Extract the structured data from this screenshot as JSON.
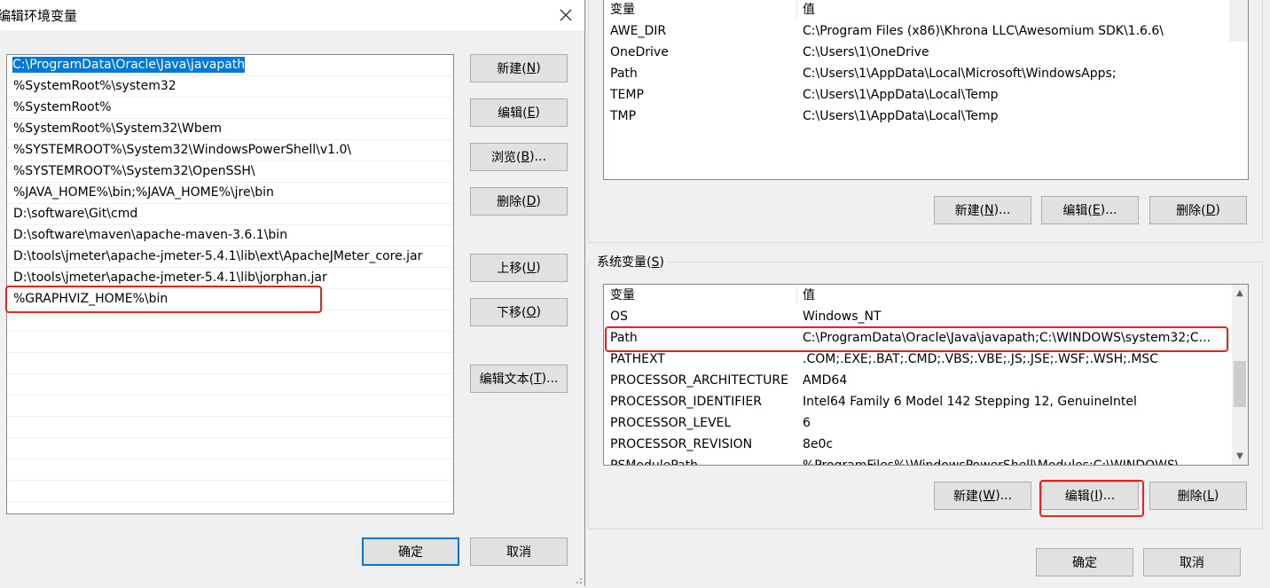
{
  "edit_dialog": {
    "title": "编辑环境变量",
    "entries": [
      "C:\\ProgramData\\Oracle\\Java\\javapath",
      "%SystemRoot%\\system32",
      "%SystemRoot%",
      "%SystemRoot%\\System32\\Wbem",
      "%SYSTEMROOT%\\System32\\WindowsPowerShell\\v1.0\\",
      "%SYSTEMROOT%\\System32\\OpenSSH\\",
      "%JAVA_HOME%\\bin;%JAVA_HOME%\\jre\\bin",
      "D:\\software\\Git\\cmd",
      "D:\\software\\maven\\apache-maven-3.6.1\\bin",
      "D:\\tools\\jmeter\\apache-jmeter-5.4.1\\lib\\ext\\ApacheJMeter_core.jar",
      "D:\\tools\\jmeter\\apache-jmeter-5.4.1\\lib\\jorphan.jar",
      "%GRAPHVIZ_HOME%\\bin"
    ],
    "selected_entry": "C:\\ProgramData\\Oracle\\Java\\javapath",
    "buttons": {
      "new": {
        "label": "新建(",
        "key": "N",
        "end": ")"
      },
      "edit": {
        "label": "编辑(",
        "key": "E",
        "end": ")"
      },
      "browse": {
        "label": "浏览(",
        "key": "B",
        "end": ")..."
      },
      "delete": {
        "label": "删除(",
        "key": "D",
        "end": ")"
      },
      "move_up": {
        "label": "上移(",
        "key": "U",
        "end": ")"
      },
      "move_down": {
        "label": "下移(",
        "key": "O",
        "end": ")"
      },
      "edit_text": {
        "label": "编辑文本(",
        "key": "T",
        "end": ")..."
      },
      "ok": "确定",
      "cancel": "取消"
    }
  },
  "env_dialog": {
    "user_vars": {
      "col_variable": "变量",
      "col_value": "值",
      "rows": [
        {
          "name": "AWE_DIR",
          "value": "C:\\Program Files (x86)\\Khrona LLC\\Awesomium SDK\\1.6.6\\"
        },
        {
          "name": "OneDrive",
          "value": "C:\\Users\\1\\OneDrive"
        },
        {
          "name": "Path",
          "value": "C:\\Users\\1\\AppData\\Local\\Microsoft\\WindowsApps;"
        },
        {
          "name": "TEMP",
          "value": "C:\\Users\\1\\AppData\\Local\\Temp"
        },
        {
          "name": "TMP",
          "value": "C:\\Users\\1\\AppData\\Local\\Temp"
        }
      ],
      "buttons": {
        "new": {
          "label": "新建(",
          "key": "N",
          "end": ")..."
        },
        "edit": {
          "label": "编辑(",
          "key": "E",
          "end": ")..."
        },
        "delete": {
          "label": "删除(",
          "key": "D",
          "end": ")"
        }
      }
    },
    "system_vars": {
      "group_label": "系统变量(",
      "group_key": "S",
      "group_end": ")",
      "col_variable": "变量",
      "col_value": "值",
      "rows": [
        {
          "name": "OS",
          "value": "Windows_NT"
        },
        {
          "name": "Path",
          "value": "C:\\ProgramData\\Oracle\\Java\\javapath;C:\\WINDOWS\\system32;C..."
        },
        {
          "name": "PATHEXT",
          "value": ".COM;.EXE;.BAT;.CMD;.VBS;.VBE;.JS;.JSE;.WSF;.WSH;.MSC"
        },
        {
          "name": "PROCESSOR_ARCHITECTURE",
          "value": "AMD64"
        },
        {
          "name": "PROCESSOR_IDENTIFIER",
          "value": "Intel64 Family 6 Model 142 Stepping 12, GenuineIntel"
        },
        {
          "name": "PROCESSOR_LEVEL",
          "value": "6"
        },
        {
          "name": "PROCESSOR_REVISION",
          "value": "8e0c"
        },
        {
          "name": "PSModulePath",
          "value": "%ProgramFiles%\\WindowsPowerShell\\Modules;C:\\WINDOWS\\..."
        }
      ],
      "buttons": {
        "new": {
          "label": "新建(",
          "key": "W",
          "end": ")..."
        },
        "edit": {
          "label": "编辑(",
          "key": "I",
          "end": ")..."
        },
        "delete": {
          "label": "删除(",
          "key": "L",
          "end": ")"
        }
      }
    },
    "ok": "确定",
    "cancel": "取消"
  },
  "colors": {
    "selection": "#0078d7",
    "highlight_box": "#e8231c"
  }
}
